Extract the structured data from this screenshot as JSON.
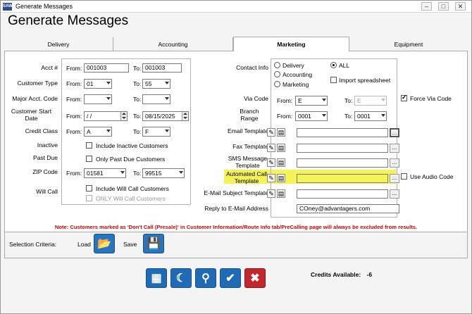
{
  "window": {
    "app_icon": "SAW",
    "title": "Generate Messages",
    "min": "–",
    "max": "□",
    "close": "✕"
  },
  "heading": "Generate Messages",
  "tabs": [
    "Delivery",
    "Accounting",
    "Marketing",
    "Equipment"
  ],
  "left": {
    "acct": {
      "label": "Acct #",
      "from_label": "From:",
      "from": "001003",
      "to_label": "To:",
      "to": "001003"
    },
    "customer_type": {
      "label": "Customer Type",
      "from_label": "From:",
      "from": "01",
      "to_label": "To:",
      "to": "55"
    },
    "major_acct": {
      "label": "Major Acct. Code",
      "from_label": "From:",
      "from": "",
      "to_label": "To:",
      "to": ""
    },
    "start_date": {
      "label": "Customer Start Date",
      "from_label": "From:",
      "from": " / /",
      "to_label": "To:",
      "to": "08/15/2025"
    },
    "credit_class": {
      "label": "Credit Class",
      "from_label": "From:",
      "from": "A",
      "to_label": "To:",
      "to": "F"
    },
    "inactive": {
      "label": "Inactive",
      "option": "Include Inactive Customers"
    },
    "past_due": {
      "label": "Past Due",
      "option": "Only Past Due Customers"
    },
    "zip": {
      "label": "ZIP Code",
      "from_label": "From:",
      "from": "01581",
      "to_label": "To:",
      "to": "99515"
    },
    "will_call": {
      "label": "Will Call",
      "option1": "Include Will Call Customers",
      "option2": "ONLY Will Call Customers"
    }
  },
  "right": {
    "contact_info": {
      "label": "Contact Info",
      "delivery": "Delivery",
      "accounting": "Accounting",
      "marketing": "Marketing",
      "all": "ALL",
      "import": "Import spreadsheet"
    },
    "via_code": {
      "label": "Via Code",
      "from_label": "From:",
      "from": "E",
      "to_label": "To:",
      "to": "E",
      "force": "Force Via Code"
    },
    "branch_range": {
      "label": "Branch Range",
      "from_label": "From:",
      "from": "0001",
      "to_label": "To:",
      "to": "0001"
    },
    "email_template": {
      "label": "Email Template",
      "value": ""
    },
    "fax_template": {
      "label": "Fax Template",
      "value": ""
    },
    "sms_template": {
      "label": "SMS Message Template",
      "value": ""
    },
    "automated_call": {
      "label": "Automated Call Template",
      "value": "",
      "audio": "Use Audio Code"
    },
    "email_subject": {
      "label": "E-Mail Subject Template",
      "value": ""
    },
    "reply_to": {
      "label": "Reply to E-Mail Address",
      "value": "COney@advantagers.com"
    }
  },
  "ellipsis": "...",
  "note": "Note: Customers marked as 'Don't Call (Presale)' in Customer Information/Route Info tab/PreCalling page will always be excluded from results.",
  "selection": {
    "label": "Selection Criteria:",
    "load": "Load",
    "save": "Save"
  },
  "credits": {
    "label": "Credits Available:",
    "value": "-6"
  },
  "colors": {
    "highlight": "#f6f35a",
    "note": "#d00000",
    "button_blue": "#1f6bb5",
    "cancel_red": "#c0282d"
  }
}
